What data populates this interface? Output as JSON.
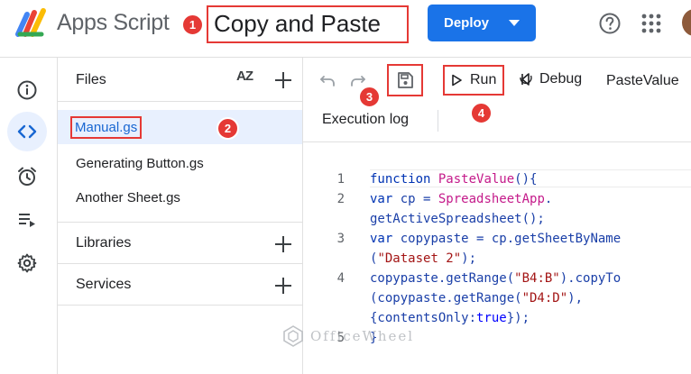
{
  "header": {
    "app_name": "Apps Script",
    "project_title": "Copy and Paste",
    "deploy_label": "Deploy"
  },
  "badges": {
    "b1": "1",
    "b2": "2",
    "b3": "3",
    "b4": "4"
  },
  "files_panel": {
    "title": "Files",
    "sort_label": "AZ",
    "files": [
      "Manual.gs",
      "Generating Button.gs",
      "Another Sheet.gs"
    ],
    "libraries_label": "Libraries",
    "services_label": "Services"
  },
  "toolbar": {
    "run_label": "Run",
    "debug_label": "Debug",
    "function_name": "PasteValue",
    "execution_log_label": "Execution log"
  },
  "code": {
    "line_numbers": [
      "1",
      "2",
      "",
      "3",
      "",
      "4",
      "",
      "",
      "5"
    ]
  },
  "watermark": "OfficeWheel",
  "colors": {
    "accent_blue": "#1a73e8",
    "annotation_red": "#e53935",
    "selected_bg": "#e8f0fe"
  }
}
